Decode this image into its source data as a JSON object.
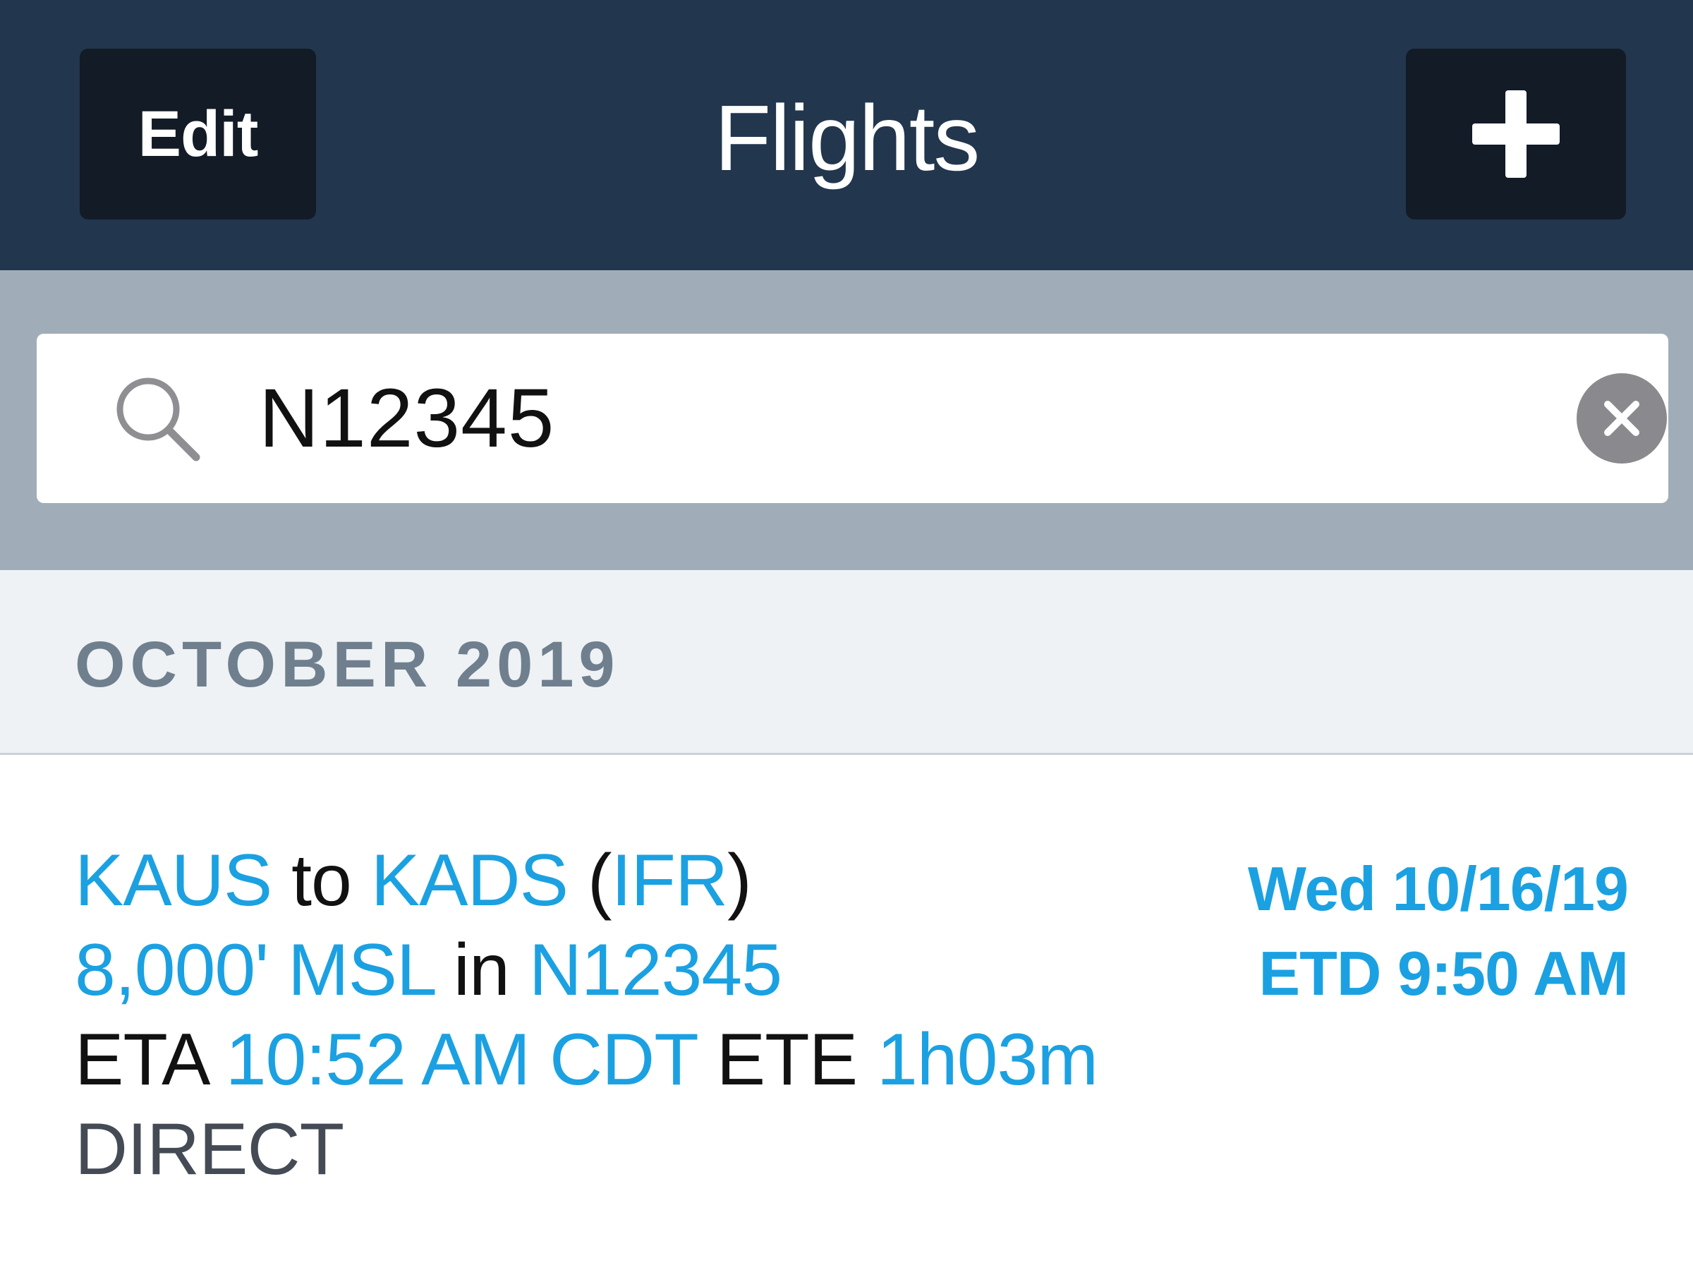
{
  "navbar": {
    "title": "Flights",
    "edit_label": "Edit",
    "add_icon": "plus-icon",
    "background": "#22364e",
    "button_background": "#121b26"
  },
  "search": {
    "value": "N12345",
    "search_icon": "search-icon",
    "clear_icon": "clear-icon",
    "background": "#a0adb9"
  },
  "section": {
    "title": "OCTOBER 2019"
  },
  "flight": {
    "origin": "KAUS",
    "to_word": "to",
    "destination": "KADS",
    "open_paren": "(",
    "flight_rules": "IFR",
    "close_paren": ")",
    "altitude": "8,000' MSL",
    "in_word": "in",
    "aircraft": "N12345",
    "eta_label": "ETA",
    "eta_value": "10:52 AM CDT",
    "ete_label": "ETE",
    "ete_value": "1h03m",
    "route": "DIRECT",
    "date": "Wed 10/16/19",
    "etd": "ETD 9:50 AM"
  },
  "colors": {
    "accent": "#1ba1e2",
    "section_text": "#6f7f8e",
    "section_background": "#eef2f5"
  }
}
